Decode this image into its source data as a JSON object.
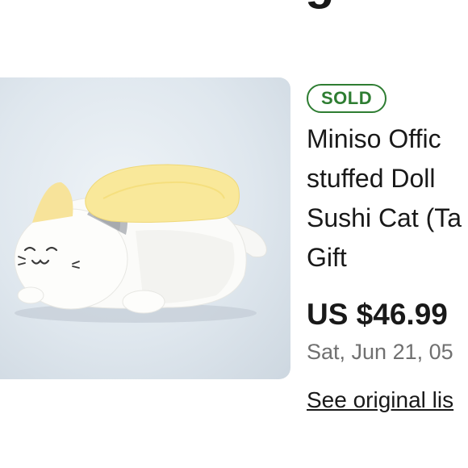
{
  "header": {
    "title_fragment": "g"
  },
  "listing": {
    "status_badge": "SOLD",
    "title_lines": [
      "Miniso Offic",
      "stuffed Doll",
      "Sushi Cat (Ta",
      "Gift"
    ],
    "price": "US $46.99",
    "sold_date": "Sat, Jun 21, 05",
    "see_original_link": "See original lis"
  },
  "colors": {
    "badge_green": "#2e7d32",
    "text_primary": "#191919",
    "text_secondary": "#707070",
    "photo_background": "#dfe7ee"
  },
  "icons": {
    "product_image": "sushi-cat-plush-image"
  }
}
